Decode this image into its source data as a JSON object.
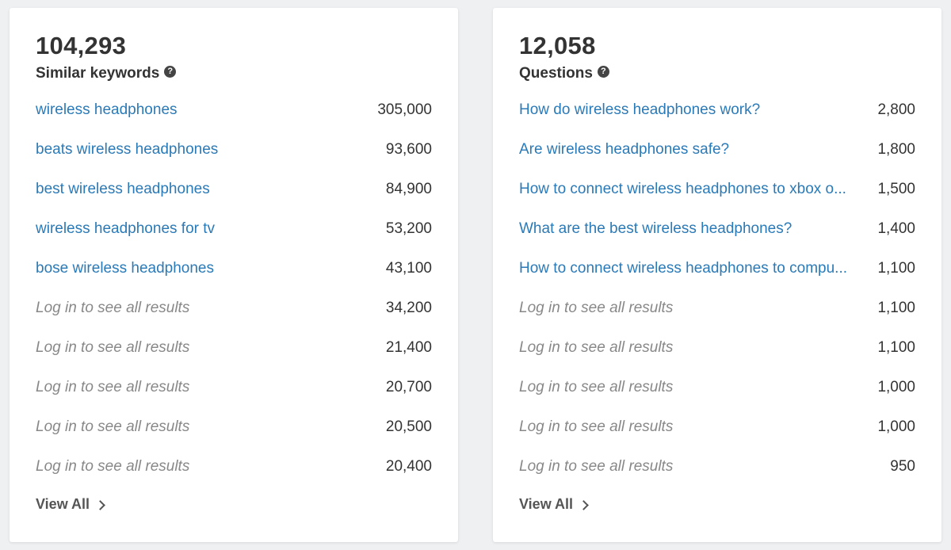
{
  "similar": {
    "count": "104,293",
    "label": "Similar keywords",
    "help_icon": "question-circle-icon",
    "rows": [
      {
        "keyword": "wireless headphones",
        "volume": "305,000",
        "locked": false
      },
      {
        "keyword": "beats wireless headphones",
        "volume": "93,600",
        "locked": false
      },
      {
        "keyword": "best wireless headphones",
        "volume": "84,900",
        "locked": false
      },
      {
        "keyword": "wireless headphones for tv",
        "volume": "53,200",
        "locked": false
      },
      {
        "keyword": "bose wireless headphones",
        "volume": "43,100",
        "locked": false
      },
      {
        "keyword": "Log in to see all results",
        "volume": "34,200",
        "locked": true
      },
      {
        "keyword": "Log in to see all results",
        "volume": "21,400",
        "locked": true
      },
      {
        "keyword": "Log in to see all results",
        "volume": "20,700",
        "locked": true
      },
      {
        "keyword": "Log in to see all results",
        "volume": "20,500",
        "locked": true
      },
      {
        "keyword": "Log in to see all results",
        "volume": "20,400",
        "locked": true
      }
    ],
    "view_all": "View All"
  },
  "questions": {
    "count": "12,058",
    "label": "Questions",
    "help_icon": "question-circle-icon",
    "rows": [
      {
        "keyword": "How do wireless headphones work?",
        "volume": "2,800",
        "locked": false
      },
      {
        "keyword": "Are wireless headphones safe?",
        "volume": "1,800",
        "locked": false
      },
      {
        "keyword": "How to connect wireless headphones to xbox o...",
        "volume": "1,500",
        "locked": false
      },
      {
        "keyword": "What are the best wireless headphones?",
        "volume": "1,400",
        "locked": false
      },
      {
        "keyword": "How to connect wireless headphones to compu...",
        "volume": "1,100",
        "locked": false
      },
      {
        "keyword": "Log in to see all results",
        "volume": "1,100",
        "locked": true
      },
      {
        "keyword": "Log in to see all results",
        "volume": "1,100",
        "locked": true
      },
      {
        "keyword": "Log in to see all results",
        "volume": "1,000",
        "locked": true
      },
      {
        "keyword": "Log in to see all results",
        "volume": "1,000",
        "locked": true
      },
      {
        "keyword": "Log in to see all results",
        "volume": "950",
        "locked": true
      }
    ],
    "view_all": "View All"
  },
  "colors": {
    "link": "#2a7ab8",
    "locked_text": "#888888",
    "background": "#eef0f2",
    "card": "#ffffff"
  }
}
